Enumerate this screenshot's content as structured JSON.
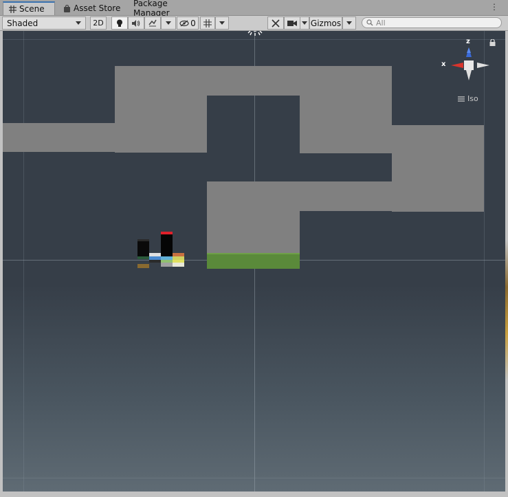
{
  "tabs": [
    {
      "label": "Scene",
      "icon": "grid-icon",
      "active": true
    },
    {
      "label": "Asset Store",
      "icon": "bag-icon",
      "active": false
    },
    {
      "label": "Package Manager",
      "icon": "",
      "active": false
    }
  ],
  "toolbar": {
    "shading_mode": "Shaded",
    "mode_2d": "2D",
    "hidden_count": "0",
    "gizmos": "Gizmos",
    "search_placeholder": "All"
  },
  "gizmo": {
    "x_label": "x",
    "z_label": "z",
    "projection": "Iso"
  },
  "colors": {
    "sky_top": "#363e48",
    "sky_bottom": "#5f6b74",
    "block": "#808080",
    "ground": "#5a8a3a",
    "axis_x": "#d8342c",
    "axis_z": "#3a6ad8"
  }
}
